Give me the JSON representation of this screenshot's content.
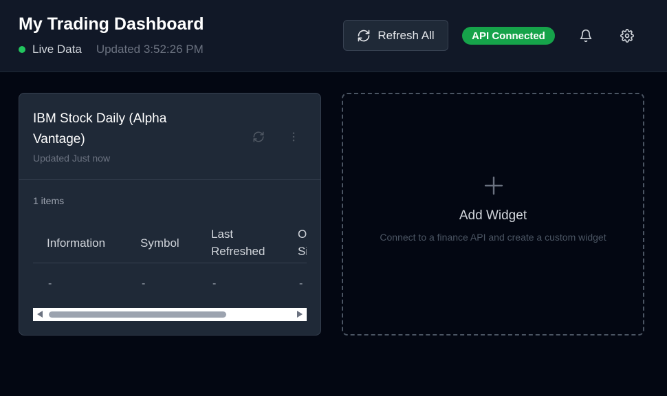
{
  "header": {
    "title": "My Trading Dashboard",
    "live_label": "Live Data",
    "updated_text": "Updated 3:52:26 PM",
    "refresh_label": "Refresh All",
    "api_badge": "API Connected",
    "icons": [
      "refresh-icon",
      "bell-icon",
      "gear-icon"
    ]
  },
  "widget": {
    "title": "IBM Stock Daily (Alpha Vantage)",
    "updated": "Updated Just now",
    "items_count": "1 items",
    "columns": [
      "Information",
      "Symbol",
      "Last Refreshed",
      "Output Size"
    ],
    "visible_column_fragment": "O Si",
    "rows": [
      [
        "-",
        "-",
        "-",
        "-"
      ]
    ]
  },
  "add_widget": {
    "title": "Add Widget",
    "description": "Connect to a finance API and create a custom widget"
  },
  "colors": {
    "background": "#030712",
    "header": "#111827",
    "card": "#1f2937",
    "live_dot": "#22c55e",
    "api_badge": "#16a34a"
  }
}
